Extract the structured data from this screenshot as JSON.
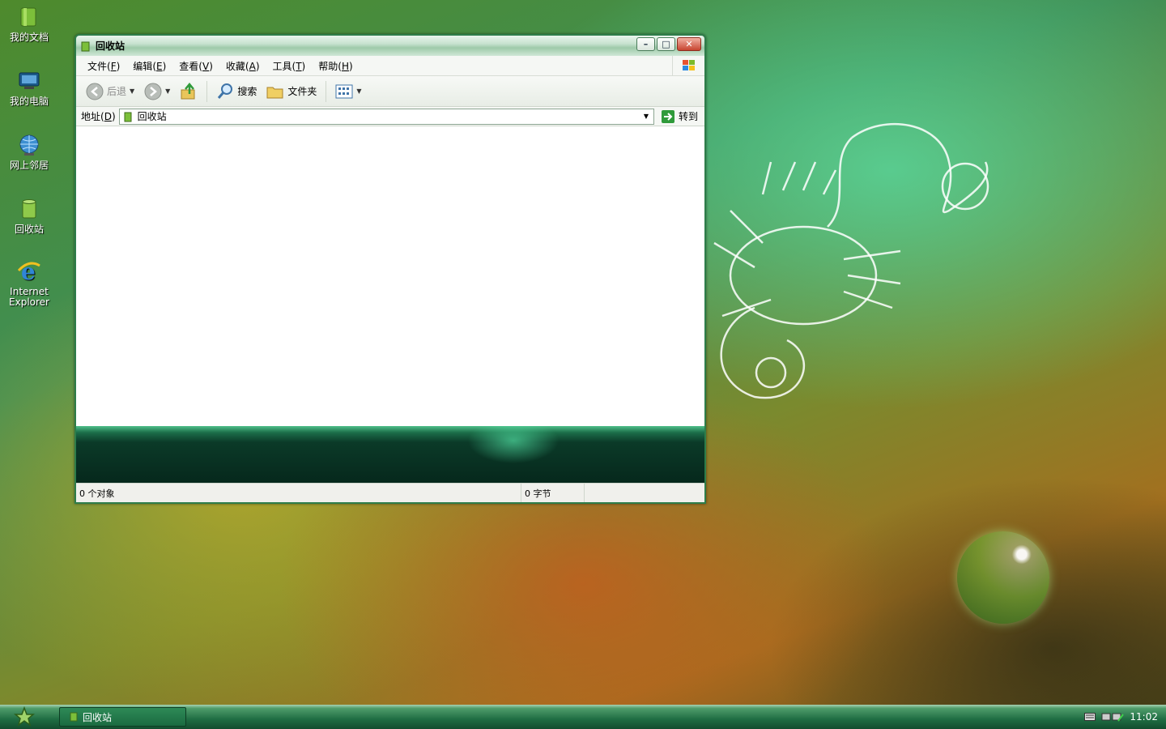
{
  "desktop": {
    "icons": [
      {
        "label": "我的文档",
        "icon": "my-documents-icon"
      },
      {
        "label": "我的电脑",
        "icon": "my-computer-icon"
      },
      {
        "label": "网上邻居",
        "icon": "network-places-icon"
      },
      {
        "label": "回收站",
        "icon": "recycle-bin-icon"
      },
      {
        "label_line1": "Internet",
        "label_line2": "Explorer",
        "icon": "ie-icon"
      }
    ]
  },
  "window": {
    "title": "回收站",
    "menu": [
      {
        "label": "文件",
        "key": "F"
      },
      {
        "label": "编辑",
        "key": "E"
      },
      {
        "label": "查看",
        "key": "V"
      },
      {
        "label": "收藏",
        "key": "A"
      },
      {
        "label": "工具",
        "key": "T"
      },
      {
        "label": "帮助",
        "key": "H"
      }
    ],
    "toolbar": {
      "back_label": "后退",
      "search_label": "搜索",
      "folders_label": "文件夹"
    },
    "address": {
      "label": "地址",
      "key": "D",
      "value": "回收站",
      "go_label": "转到"
    },
    "status": {
      "objects": "0 个对象",
      "size": "0 字节"
    }
  },
  "taskbar": {
    "task_label": "回收站",
    "clock": "11:02"
  },
  "colors": {
    "accent": "#2e7d4a",
    "taskbar": "#1f6d43"
  }
}
